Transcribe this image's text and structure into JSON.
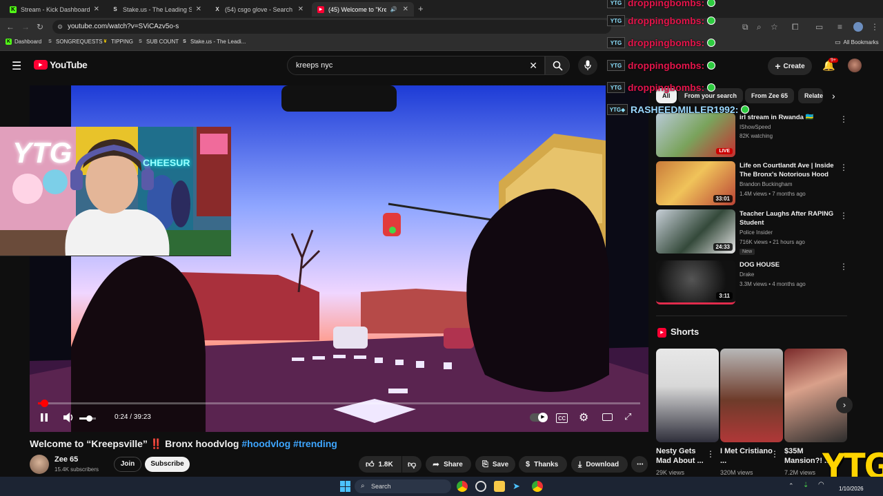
{
  "tabs": [
    {
      "label": "Stream - Kick Dashboard",
      "favicon": "K",
      "color": "#53fc18"
    },
    {
      "label": "Stake.us - The Leading Soc",
      "favicon": "S",
      "color": "#dddddd"
    },
    {
      "label": "(54) csgo glove - Search / X",
      "favicon": "X",
      "color": "#dddddd"
    },
    {
      "label": "(45) Welcome to \"Kreepsvil",
      "favicon": "▶",
      "color": "#ff0033"
    }
  ],
  "address": {
    "url": "youtube.com/watch?v=SViCAzv5o-s"
  },
  "bookmarks": [
    {
      "label": "Dashboard",
      "icon": "K",
      "color": "#53fc18"
    },
    {
      "label": "SONGREQUESTS",
      "icon": "S",
      "color": "#aaa"
    },
    {
      "label": "TIPPING",
      "icon": "¥",
      "color": "#ffd400"
    },
    {
      "label": "SUB COUNT",
      "icon": "S",
      "color": "#aaa"
    },
    {
      "label": "Stake.us - The Leadi...",
      "icon": "S",
      "color": "#ddd"
    }
  ],
  "all_bookmarks": "All Bookmarks",
  "youtube": {
    "logo_text": "YouTube",
    "search_value": "kreeps nyc",
    "create_label": "Create",
    "notif_count": "9+"
  },
  "player": {
    "time": "0:24 / 39:23",
    "progress": 0.01,
    "volume": 0.6
  },
  "video": {
    "title_main": "Welcome to “Kreepsville”",
    "title_bang": "‼️",
    "title_rest": "Bronx hoodvlog",
    "tag1": "#hoodvlog",
    "tag2": "#trending",
    "channel": "Zee 65",
    "subscribers": "15.4K subscribers",
    "join_label": "Join",
    "subscribe_label": "Subscribe",
    "likes": "1.8K",
    "share_label": "Share",
    "save_label": "Save",
    "thanks_label": "Thanks",
    "download_label": "Download"
  },
  "chips": [
    "All",
    "From your search",
    "From Zee 65",
    "Relate"
  ],
  "recommendations": [
    {
      "title": "irl stream in Rwanda 🇷🇼",
      "channel": "IShowSpeed",
      "meta": "82K watching",
      "badge": "LIVE"
    },
    {
      "title": "Life on Courtlandt Ave | Inside The Bronx's Notorious Hood",
      "channel": "Brandon Buckingham",
      "meta": "1.4M views • 7 months ago",
      "duration": "33:01"
    },
    {
      "title": "Teacher Laughs After RAPING Student",
      "channel": "Police Insider",
      "meta": "716K views • 21 hours ago",
      "new": "New",
      "duration": "24:33"
    },
    {
      "title": "DOG HOUSE",
      "channel": "Drake",
      "meta": "3.3M views • 4 months ago",
      "duration": "3:11"
    }
  ],
  "shorts": {
    "title": "Shorts",
    "items": [
      {
        "title": "Nesty Gets Mad About ...",
        "views": "29K views"
      },
      {
        "title": "I Met Cristiano ...",
        "views": "320M views"
      },
      {
        "title": "$35M Mansion?! ...",
        "views": "7.2M views"
      }
    ]
  },
  "chat": [
    {
      "name": "droppingbombs:"
    },
    {
      "name": "droppingbombs:"
    },
    {
      "name": "droppingbombs:"
    },
    {
      "name": "droppingbombs:"
    },
    {
      "name": "droppingbombs:"
    },
    {
      "name": "RASHEEDMILLER1992:"
    }
  ],
  "webcam": {
    "sign1": "YTG",
    "sign2": "CHEESUR"
  },
  "overlay_logo": "YTG",
  "taskbar": {
    "search_placeholder": "Search",
    "date": "1/10/2026"
  }
}
